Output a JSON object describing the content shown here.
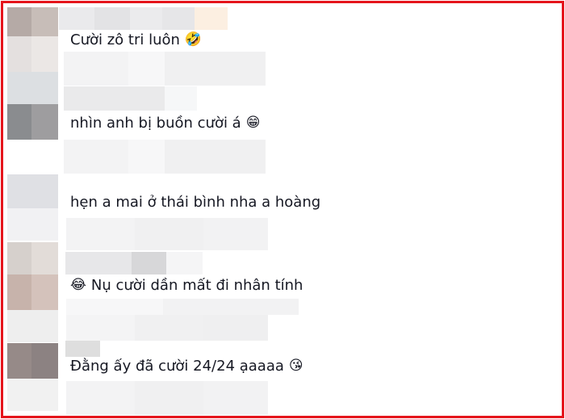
{
  "comments": [
    {
      "text": "Cười zô tri luôn",
      "emoji": "🤣",
      "emoji_name": "rolling-laughing-icon"
    },
    {
      "text": "nhìn anh bị buồn cười á",
      "emoji": "😁",
      "emoji_name": "grinning-icon"
    },
    {
      "text": "hẹn a mai ở thái bình nha a hoàng",
      "emoji": "",
      "emoji_name": ""
    },
    {
      "text": "Nụ cười dần mất đi nhân tính",
      "emoji": "😂",
      "emoji_name": "tears-of-joy-icon",
      "emoji_first": true
    },
    {
      "text": "Đằng ấy đã cười 24/24 ạaaaa",
      "emoji": "😘",
      "emoji_name": "kiss-icon"
    }
  ],
  "colors": {
    "border": "#e5141b",
    "text": "#161823"
  }
}
